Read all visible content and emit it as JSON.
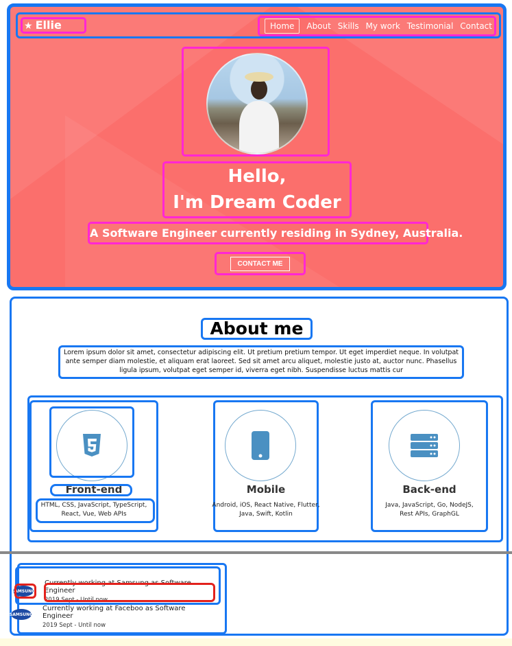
{
  "nav": {
    "brand": "Ellie",
    "items": [
      {
        "label": "Home",
        "active": true
      },
      {
        "label": "About"
      },
      {
        "label": "Skills"
      },
      {
        "label": "My work"
      },
      {
        "label": "Testimonial"
      },
      {
        "label": "Contact"
      }
    ]
  },
  "hero": {
    "greeting_line1": "Hello,",
    "greeting_line2": "I'm Dream Coder",
    "subtitle": "A Software Engineer currently residing in Sydney, Australia.",
    "cta_label": "CONTACT ME",
    "accent_color": "#fb6f6c"
  },
  "about": {
    "title": "About me",
    "text": "Lorem ipsum dolor sit amet, consectetur adipiscing elit. Ut pretium pretium tempor. Ut eget imperdiet neque. In volutpat ante semper diam molestie, et aliquam erat laoreet. Sed sit amet arcu aliquet, molestie justo at, auctor nunc. Phasellus ligula ipsum, volutpat eget semper id, viverra eget nibh. Suspendisse luctus mattis cur"
  },
  "skills": [
    {
      "name": "Front-end",
      "icon": "html5-icon",
      "desc": "HTML, CSS, JavaScript, TypeScript, React, Vue, Web APIs"
    },
    {
      "name": "Mobile",
      "icon": "mobile-icon",
      "desc": "Android, iOS, React Native, Flutter, Java, Swift, Kotlin"
    },
    {
      "name": "Back-end",
      "icon": "server-icon",
      "desc": "Java, JavaScript, Go, NodeJS, Rest APIs, GraphGL"
    }
  ],
  "experience": [
    {
      "logo": "SAMSUNG",
      "title": "Currently working at Samsung as Software Engineer",
      "date": "2019 Sept - Until now"
    },
    {
      "logo": "SAMSUNG",
      "title": "Currently working at Faceboo as Software Engineer",
      "date": "2019 Sept - Until now"
    }
  ]
}
